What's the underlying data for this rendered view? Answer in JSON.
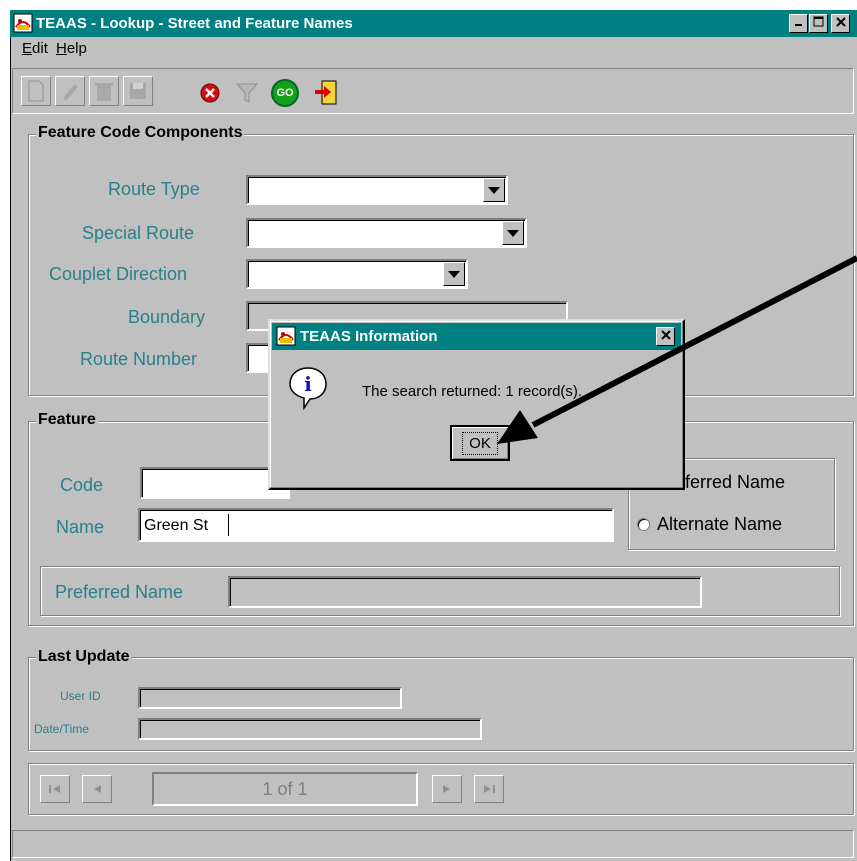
{
  "window": {
    "title": "TEAAS - Lookup - Street and Feature Names"
  },
  "menu": {
    "edit_pre": "E",
    "edit_rest": "dit",
    "help_pre": "H",
    "help_rest": "elp"
  },
  "toolbar": {
    "go_label": "GO"
  },
  "feature_code": {
    "heading": "Feature Code Components",
    "route_type_label": "Route Type",
    "special_route_label": "Special Route",
    "couplet_direction_label": "Couplet Direction",
    "boundary_label": "Boundary",
    "route_number_label": "Route Number"
  },
  "feature": {
    "heading": "Feature",
    "code_label": "Code",
    "code_value": "",
    "name_label": "Name",
    "name_value": "Green St",
    "preferred_radio_label": "Preferred Name",
    "alternate_radio_label": "Alternate Name",
    "preferred_name_label": "Preferred Name",
    "preferred_name_value": ""
  },
  "last_update": {
    "heading": "Last Update",
    "user_id_label": "User ID",
    "datetime_label": "Date/Time"
  },
  "navigation": {
    "record_position": "1 of 1"
  },
  "dialog": {
    "title": "TEAAS Information",
    "message": "The search returned: 1 record(s).",
    "ok_label": "OK"
  },
  "colors": {
    "titlebar": "#008080",
    "label_teal": "#27808a",
    "window_bg": "#c0c0c0"
  }
}
